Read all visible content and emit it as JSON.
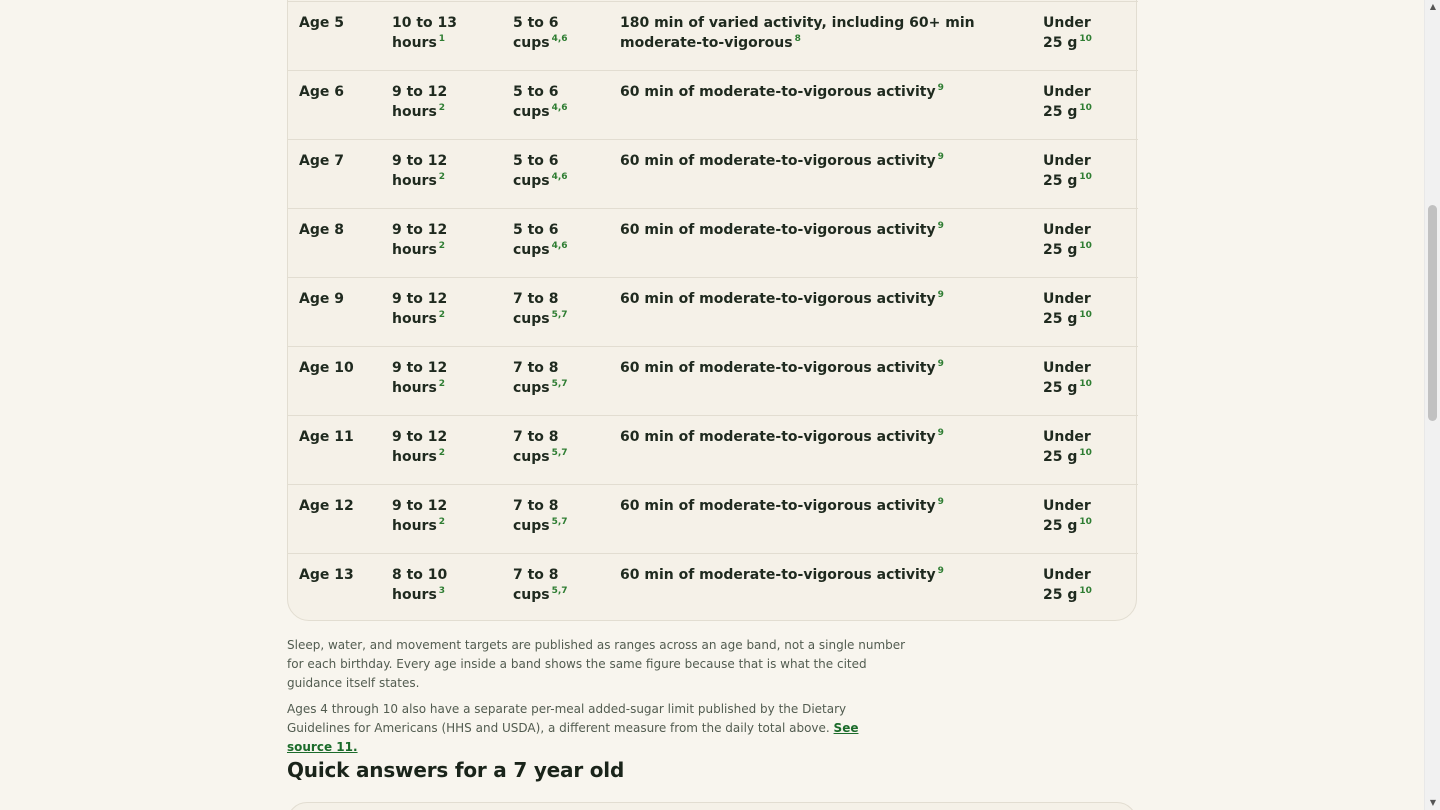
{
  "table": {
    "rows": [
      {
        "age": "Age 5",
        "sleep": "10 to 13 hours",
        "sleep_ref": "1",
        "water": "5 to 6 cups",
        "water_ref": "4,6",
        "movement": "180 min of varied activity, including 60+ min moderate-to-vigorous",
        "movement_ref": "8",
        "sugar": "Under 25 g",
        "sugar_ref": "10"
      },
      {
        "age": "Age 6",
        "sleep": "9 to 12 hours",
        "sleep_ref": "2",
        "water": "5 to 6 cups",
        "water_ref": "4,6",
        "movement": "60 min of moderate-to-vigorous activity",
        "movement_ref": "9",
        "sugar": "Under 25 g",
        "sugar_ref": "10"
      },
      {
        "age": "Age 7",
        "sleep": "9 to 12 hours",
        "sleep_ref": "2",
        "water": "5 to 6 cups",
        "water_ref": "4,6",
        "movement": "60 min of moderate-to-vigorous activity",
        "movement_ref": "9",
        "sugar": "Under 25 g",
        "sugar_ref": "10"
      },
      {
        "age": "Age 8",
        "sleep": "9 to 12 hours",
        "sleep_ref": "2",
        "water": "5 to 6 cups",
        "water_ref": "4,6",
        "movement": "60 min of moderate-to-vigorous activity",
        "movement_ref": "9",
        "sugar": "Under 25 g",
        "sugar_ref": "10"
      },
      {
        "age": "Age 9",
        "sleep": "9 to 12 hours",
        "sleep_ref": "2",
        "water": "7 to 8 cups",
        "water_ref": "5,7",
        "movement": "60 min of moderate-to-vigorous activity",
        "movement_ref": "9",
        "sugar": "Under 25 g",
        "sugar_ref": "10"
      },
      {
        "age": "Age 10",
        "sleep": "9 to 12 hours",
        "sleep_ref": "2",
        "water": "7 to 8 cups",
        "water_ref": "5,7",
        "movement": "60 min of moderate-to-vigorous activity",
        "movement_ref": "9",
        "sugar": "Under 25 g",
        "sugar_ref": "10"
      },
      {
        "age": "Age 11",
        "sleep": "9 to 12 hours",
        "sleep_ref": "2",
        "water": "7 to 8 cups",
        "water_ref": "5,7",
        "movement": "60 min of moderate-to-vigorous activity",
        "movement_ref": "9",
        "sugar": "Under 25 g",
        "sugar_ref": "10"
      },
      {
        "age": "Age 12",
        "sleep": "9 to 12 hours",
        "sleep_ref": "2",
        "water": "7 to 8 cups",
        "water_ref": "5,7",
        "movement": "60 min of moderate-to-vigorous activity",
        "movement_ref": "9",
        "sugar": "Under 25 g",
        "sugar_ref": "10"
      },
      {
        "age": "Age 13",
        "sleep": "8 to 10 hours",
        "sleep_ref": "3",
        "water": "7 to 8 cups",
        "water_ref": "5,7",
        "movement": "60 min of moderate-to-vigorous activity",
        "movement_ref": "9",
        "sugar": "Under 25 g",
        "sugar_ref": "10"
      }
    ]
  },
  "notes": {
    "band_note": "Sleep, water, and movement targets are published as ranges across an age band, not a single number for each birthday. Every age inside a band shows the same figure because that is what the cited guidance itself states.",
    "sugar_note": "Ages 4 through 10 also have a separate per-meal added-sugar limit published by the Dietary Guidelines for Americans (HHS and USDA), a different measure from the daily total above.",
    "source_link": "See source 11."
  },
  "section": {
    "title": "Quick answers for a 7 year old"
  },
  "scrollbar": {
    "up_icon": "triangle-up",
    "down_icon": "triangle-down",
    "up_glyph": "▲",
    "down_glyph": "▼"
  }
}
